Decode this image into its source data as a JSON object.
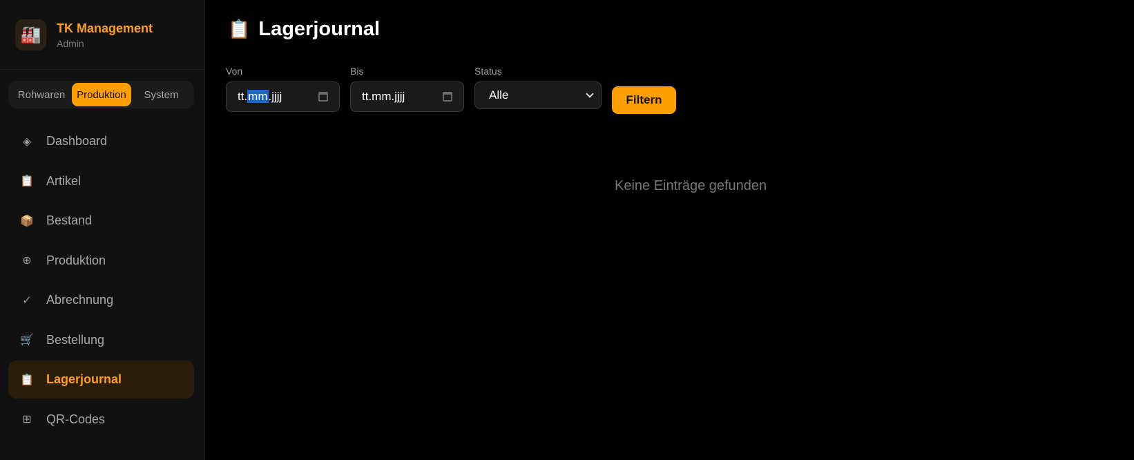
{
  "brand": {
    "logo_icon": "🏭",
    "title": "TK Management",
    "subtitle": "Admin"
  },
  "segments": [
    {
      "label": "Rohwaren",
      "active": false
    },
    {
      "label": "Produktion",
      "active": true
    },
    {
      "label": "System",
      "active": false
    }
  ],
  "nav": [
    {
      "label": "Dashboard",
      "icon": "◈",
      "icon_name": "dashboard-icon"
    },
    {
      "label": "Artikel",
      "icon": "📋",
      "icon_name": "clipboard-icon"
    },
    {
      "label": "Bestand",
      "icon": "📦",
      "icon_name": "package-icon"
    },
    {
      "label": "Produktion",
      "icon": "⊕",
      "icon_name": "circle-cross-icon"
    },
    {
      "label": "Abrechnung",
      "icon": "✓",
      "icon_name": "check-icon"
    },
    {
      "label": "Bestellung",
      "icon": "🛒",
      "icon_name": "cart-icon"
    },
    {
      "label": "Lagerjournal",
      "icon": "📋",
      "icon_name": "clipboard-icon",
      "active": true
    },
    {
      "label": "QR-Codes",
      "icon": "⊞",
      "icon_name": "grid-icon"
    }
  ],
  "page": {
    "title": "Lagerjournal",
    "title_icon": "📋"
  },
  "filters": {
    "from": {
      "label": "Von",
      "value_pre": "tt.",
      "value_hl": "mm",
      "value_post": ".jjjj"
    },
    "to": {
      "label": "Bis",
      "value": "tt.mm.jjjj"
    },
    "status": {
      "label": "Status",
      "value": "Alle"
    },
    "button_label": "Filtern"
  },
  "empty_message": "Keine Einträge gefunden",
  "colors": {
    "accent": "#ffa000",
    "background": "#000000",
    "sidebar": "#111111"
  }
}
